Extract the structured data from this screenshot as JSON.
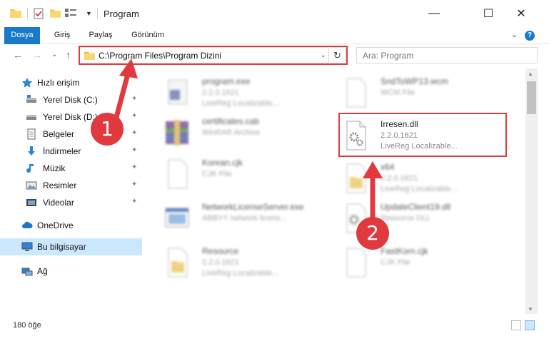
{
  "window": {
    "title": "Program",
    "minimize": "—",
    "maximize": "☐",
    "close": "✕"
  },
  "ribbon": {
    "tabs": [
      "Dosya",
      "Giriş",
      "Paylaş",
      "Görünüm"
    ],
    "expand": "⌄",
    "help": "?"
  },
  "nav": {
    "back": "←",
    "forward": "→",
    "recent": "⌄",
    "up": "↑",
    "address": "C:\\Program Files\\Program Dizini",
    "address_dropdown": "⌄",
    "refresh": "↻",
    "search_placeholder": "Ara: Program"
  },
  "sidebar": {
    "items": [
      {
        "label": "Hızlı erişim",
        "icon": "star-icon",
        "pinned": false
      },
      {
        "label": "Yerel Disk (C:)",
        "icon": "drive-icon",
        "pinned": true
      },
      {
        "label": "Yerel Disk (D:)",
        "icon": "drive-icon",
        "pinned": true
      },
      {
        "label": "Belgeler",
        "icon": "documents-icon",
        "pinned": true
      },
      {
        "label": "İndirmeler",
        "icon": "download-icon",
        "pinned": true
      },
      {
        "label": "Müzik",
        "icon": "music-icon",
        "pinned": true
      },
      {
        "label": "Resimler",
        "icon": "pictures-icon",
        "pinned": true
      },
      {
        "label": "Videolar",
        "icon": "videos-icon",
        "pinned": true
      },
      {
        "label": "OneDrive",
        "icon": "cloud-icon",
        "pinned": false
      },
      {
        "label": "Bu bilgisayar",
        "icon": "computer-icon",
        "pinned": false
      },
      {
        "label": "Ağ",
        "icon": "network-icon",
        "pinned": false
      }
    ],
    "pin_glyph": "📌"
  },
  "files": {
    "left": [
      {
        "name": "program.exe",
        "line1": "2.2.0.1621",
        "line2": "LiveReg Localizable...",
        "icon": "exe-icon"
      },
      {
        "name": "certificates.cab",
        "line1": "WinRAR Archive",
        "line2": "",
        "icon": "archive-icon"
      },
      {
        "name": "Korean.cjk",
        "line1": "CJK File",
        "line2": "",
        "icon": "blank-file-icon"
      },
      {
        "name": "NetworkLicenseServer.exe",
        "line1": "ABBYY network licens...",
        "line2": "",
        "icon": "app-window-icon"
      },
      {
        "name": "Resource",
        "line1": "2.2.0.1621",
        "line2": "LiveReg Localizable...",
        "icon": "folder-file-icon"
      }
    ],
    "right": [
      {
        "name": "SndToWP13.wcm",
        "line1": "WCM File",
        "line2": "",
        "icon": "blank-file-icon"
      },
      {
        "name": "Irresen.dll",
        "line1": "2.2.0.1621",
        "line2": "LiveReg Localizable...",
        "icon": "dll-gear-icon"
      },
      {
        "name": "x64",
        "line1": "2.2.0.1621",
        "line2": "LiveReg Localizable...",
        "icon": "folder-file-icon"
      },
      {
        "name": "UpdateClient19.dll",
        "line1": "Resource DLL",
        "line2": "",
        "icon": "dll-gear-icon"
      },
      {
        "name": "FastKorn.cjk",
        "line1": "CJK File",
        "line2": "",
        "icon": "blank-file-icon"
      }
    ]
  },
  "status": {
    "count": "180 öğe"
  },
  "callouts": {
    "one": "1",
    "two": "2"
  },
  "colors": {
    "accent": "#1979ca",
    "highlight": "#e03a3e",
    "selection": "#cce8ff"
  }
}
